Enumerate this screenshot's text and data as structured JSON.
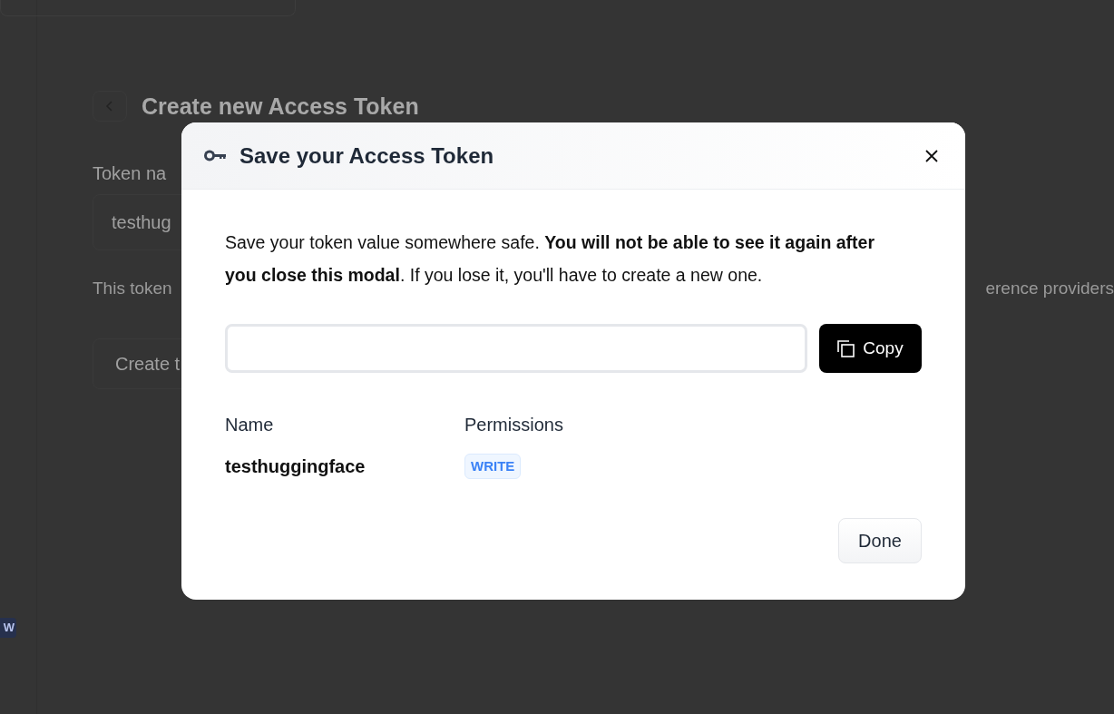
{
  "page": {
    "title": "Create new Access Token",
    "token_name_label": "Token na",
    "token_name_value": "testhug",
    "helper_text_start": "This token",
    "helper_text_end": "erence providers",
    "create_button": "Create t",
    "badge": "W"
  },
  "modal": {
    "title": "Save your Access Token",
    "message": "Save your token value somewhere safe. **You will not be able to see it again after you close this modal**. If you lose it, you'll have to create a new one.",
    "copy_button": "Copy",
    "columns": [
      "Name",
      "Permissions"
    ],
    "token": {
      "name": "testhuggingface",
      "permission": "WRITE"
    },
    "done_button": "Done"
  }
}
